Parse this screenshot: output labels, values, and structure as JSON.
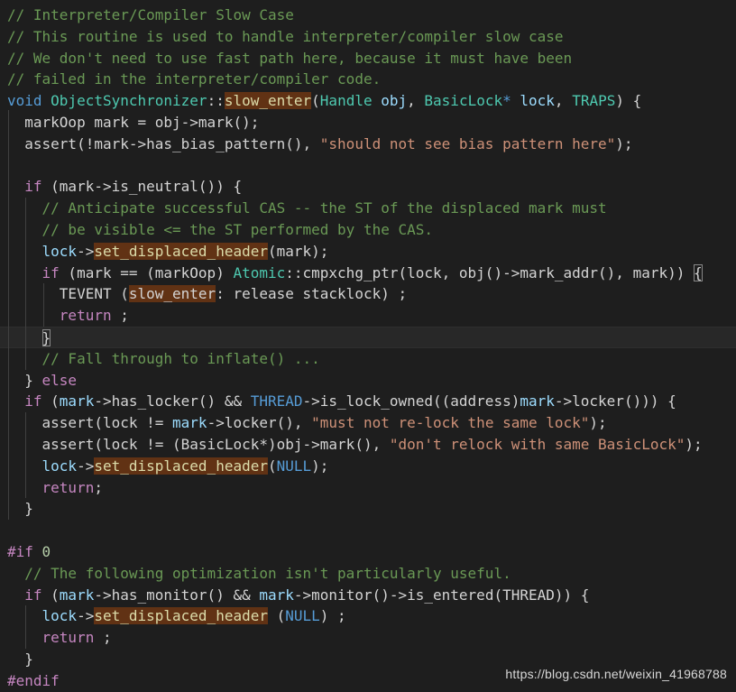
{
  "editor": {
    "theme": {
      "background": "#1e1e1e",
      "match_highlight": "#613214"
    },
    "watermark": "https://blog.csdn.net/weixin_41968788",
    "lines": [
      [
        {
          "t": "// Interpreter/Compiler Slow Case",
          "c": "c"
        }
      ],
      [
        {
          "t": "// This routine is used to handle interpreter/compiler slow case",
          "c": "c"
        }
      ],
      [
        {
          "t": "// We don't need to use fast path here, because it must have been",
          "c": "c"
        }
      ],
      [
        {
          "t": "// failed in the interpreter/compiler code.",
          "c": "c"
        }
      ],
      [
        {
          "t": "void",
          "c": "k"
        },
        {
          "t": " ",
          "c": "p"
        },
        {
          "t": "ObjectSynchronizer",
          "c": "ty"
        },
        {
          "t": "::",
          "c": "p"
        },
        {
          "t": "slow_enter",
          "c": "f",
          "h": 1
        },
        {
          "t": "(",
          "c": "p"
        },
        {
          "t": "Handle",
          "c": "ty"
        },
        {
          "t": " ",
          "c": "p"
        },
        {
          "t": "obj",
          "c": "v"
        },
        {
          "t": ", ",
          "c": "p"
        },
        {
          "t": "BasicLock",
          "c": "ty"
        },
        {
          "t": "*",
          "c": "k"
        },
        {
          "t": " ",
          "c": "p"
        },
        {
          "t": "lock",
          "c": "v"
        },
        {
          "t": ", ",
          "c": "p"
        },
        {
          "t": "TRAPS",
          "c": "ty"
        },
        {
          "t": ") {",
          "c": "p"
        }
      ],
      [
        {
          "t": "  markOop mark = obj->mark();",
          "c": "p"
        }
      ],
      [
        {
          "t": "  assert(!mark->has_bias_pattern(), ",
          "c": "p"
        },
        {
          "t": "\"should not see bias pattern here\"",
          "c": "s"
        },
        {
          "t": ");",
          "c": "p"
        }
      ],
      [],
      [
        {
          "t": "  ",
          "c": "p"
        },
        {
          "t": "if",
          "c": "kp"
        },
        {
          "t": " (mark->is_neutral()) {",
          "c": "p"
        }
      ],
      [
        {
          "t": "    // Anticipate successful CAS -- the ST of the displaced mark must",
          "c": "c"
        }
      ],
      [
        {
          "t": "    // be visible <= the ST performed by the CAS.",
          "c": "c"
        }
      ],
      [
        {
          "t": "    ",
          "c": "p"
        },
        {
          "t": "lock",
          "c": "v"
        },
        {
          "t": "->",
          "c": "p"
        },
        {
          "t": "set_displaced_header",
          "c": "f",
          "h": 1
        },
        {
          "t": "(mark);",
          "c": "p"
        }
      ],
      [
        {
          "t": "    ",
          "c": "p"
        },
        {
          "t": "if",
          "c": "kp"
        },
        {
          "t": " (mark == (markOop) ",
          "c": "p"
        },
        {
          "t": "Atomic",
          "c": "ty"
        },
        {
          "t": "::cmpxchg_ptr(lock, obj()->mark_addr(), mark)) ",
          "c": "p"
        },
        {
          "t": "{",
          "c": "p",
          "b": 1
        }
      ],
      [
        {
          "t": "      TEVENT (",
          "c": "p"
        },
        {
          "t": "slow_enter",
          "c": "p",
          "h": 1
        },
        {
          "t": ": release stacklock) ;",
          "c": "p"
        }
      ],
      [
        {
          "t": "      ",
          "c": "p"
        },
        {
          "t": "return",
          "c": "kp"
        },
        {
          "t": " ;",
          "c": "p"
        }
      ],
      [
        {
          "t": "    ",
          "c": "p"
        },
        {
          "t": "}",
          "c": "p",
          "b": 1
        }
      ],
      [
        {
          "t": "    // Fall through to inflate() ...",
          "c": "c"
        }
      ],
      [
        {
          "t": "  } ",
          "c": "p"
        },
        {
          "t": "else",
          "c": "kp"
        }
      ],
      [
        {
          "t": "  ",
          "c": "p"
        },
        {
          "t": "if",
          "c": "kp"
        },
        {
          "t": " (",
          "c": "p"
        },
        {
          "t": "mark",
          "c": "v"
        },
        {
          "t": "->has_locker() && ",
          "c": "p"
        },
        {
          "t": "THREAD",
          "c": "k"
        },
        {
          "t": "->is_lock_owned((address)",
          "c": "p"
        },
        {
          "t": "mark",
          "c": "v"
        },
        {
          "t": "->locker())) {",
          "c": "p"
        }
      ],
      [
        {
          "t": "    assert(lock != ",
          "c": "p"
        },
        {
          "t": "mark",
          "c": "v"
        },
        {
          "t": "->locker(), ",
          "c": "p"
        },
        {
          "t": "\"must not re-lock the same lock\"",
          "c": "s"
        },
        {
          "t": ");",
          "c": "p"
        }
      ],
      [
        {
          "t": "    assert(lock != (BasicLock*)obj->mark(), ",
          "c": "p"
        },
        {
          "t": "\"don't relock with same BasicLock\"",
          "c": "s"
        },
        {
          "t": ");",
          "c": "p"
        }
      ],
      [
        {
          "t": "    ",
          "c": "p"
        },
        {
          "t": "lock",
          "c": "v"
        },
        {
          "t": "->",
          "c": "p"
        },
        {
          "t": "set_displaced_header",
          "c": "f",
          "h": 1
        },
        {
          "t": "(",
          "c": "p"
        },
        {
          "t": "NULL",
          "c": "k"
        },
        {
          "t": ");",
          "c": "p"
        }
      ],
      [
        {
          "t": "    ",
          "c": "p"
        },
        {
          "t": "return",
          "c": "kp"
        },
        {
          "t": ";",
          "c": "p"
        }
      ],
      [
        {
          "t": "  }",
          "c": "p"
        }
      ],
      [],
      [
        {
          "t": "#if",
          "c": "kp"
        },
        {
          "t": " ",
          "c": "p"
        },
        {
          "t": "0",
          "c": "n"
        }
      ],
      [
        {
          "t": "  // The following optimization isn't particularly useful.",
          "c": "c"
        }
      ],
      [
        {
          "t": "  ",
          "c": "p"
        },
        {
          "t": "if",
          "c": "kp"
        },
        {
          "t": " (",
          "c": "p"
        },
        {
          "t": "mark",
          "c": "v"
        },
        {
          "t": "->has_monitor() && ",
          "c": "p"
        },
        {
          "t": "mark",
          "c": "v"
        },
        {
          "t": "->monitor()->is_entered(THREAD)) {",
          "c": "p"
        }
      ],
      [
        {
          "t": "    ",
          "c": "p"
        },
        {
          "t": "lock",
          "c": "v"
        },
        {
          "t": "->",
          "c": "p"
        },
        {
          "t": "set_displaced_header",
          "c": "f",
          "h": 1
        },
        {
          "t": " (",
          "c": "p"
        },
        {
          "t": "NULL",
          "c": "k"
        },
        {
          "t": ") ;",
          "c": "p"
        }
      ],
      [
        {
          "t": "    ",
          "c": "p"
        },
        {
          "t": "return",
          "c": "kp"
        },
        {
          "t": " ;",
          "c": "p"
        }
      ],
      [
        {
          "t": "  }",
          "c": "p"
        }
      ],
      [
        {
          "t": "#endif",
          "c": "kp"
        }
      ]
    ]
  }
}
